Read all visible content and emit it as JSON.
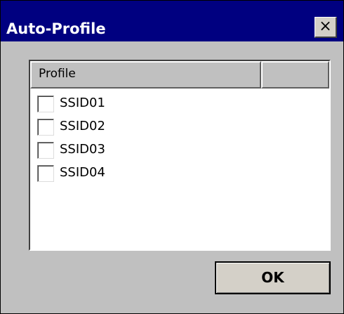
{
  "window": {
    "title": "Auto-Profile",
    "close_label": "×",
    "close_icon": "close-icon"
  },
  "list": {
    "columns": [
      "Profile",
      ""
    ],
    "items": [
      {
        "label": "SSID01",
        "checked": false
      },
      {
        "label": "SSID02",
        "checked": false
      },
      {
        "label": "SSID03",
        "checked": false
      },
      {
        "label": "SSID04",
        "checked": false
      }
    ]
  },
  "buttons": {
    "ok_label": "OK"
  },
  "colors": {
    "titlebar": "#000080",
    "window_bg": "#c0c0c0",
    "list_bg": "#ffffff"
  }
}
